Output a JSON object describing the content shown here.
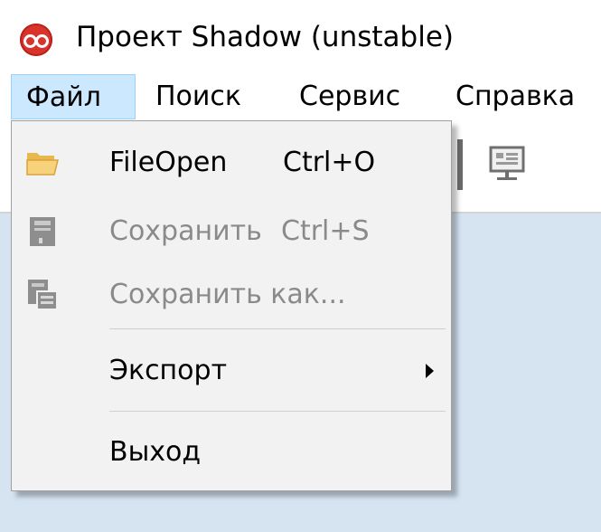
{
  "window": {
    "title": "Проект Shadow (unstable)",
    "app_icon": "app-logo-icon"
  },
  "menubar": {
    "items": [
      {
        "label": "Файл",
        "active": true
      },
      {
        "label": "Поиск",
        "active": false
      },
      {
        "label": "Сервис",
        "active": false
      },
      {
        "label": "Справка",
        "active": false
      }
    ]
  },
  "toolbar": {
    "button_icon": "presentation-icon"
  },
  "file_menu": {
    "items": [
      {
        "label": "FileOpen",
        "shortcut": "Ctrl+O",
        "icon": "folder-open-icon",
        "enabled": true
      },
      {
        "label": "Сохранить",
        "shortcut": "Ctrl+S",
        "icon": "save-icon",
        "enabled": false
      },
      {
        "label": "Сохранить как...",
        "shortcut": "",
        "icon": "save-as-icon",
        "enabled": false
      },
      {
        "label": "Экспорт",
        "shortcut": "",
        "icon": "",
        "enabled": true,
        "submenu": true
      },
      {
        "label": "Выход",
        "shortcut": "",
        "icon": "",
        "enabled": true
      }
    ]
  },
  "colors": {
    "menu_highlight": "#cce8ff",
    "menu_background": "#f2f2f2",
    "workspace": "#d6e4f2",
    "disabled_text": "#8a8a8a",
    "app_icon_red": "#d9332b"
  }
}
